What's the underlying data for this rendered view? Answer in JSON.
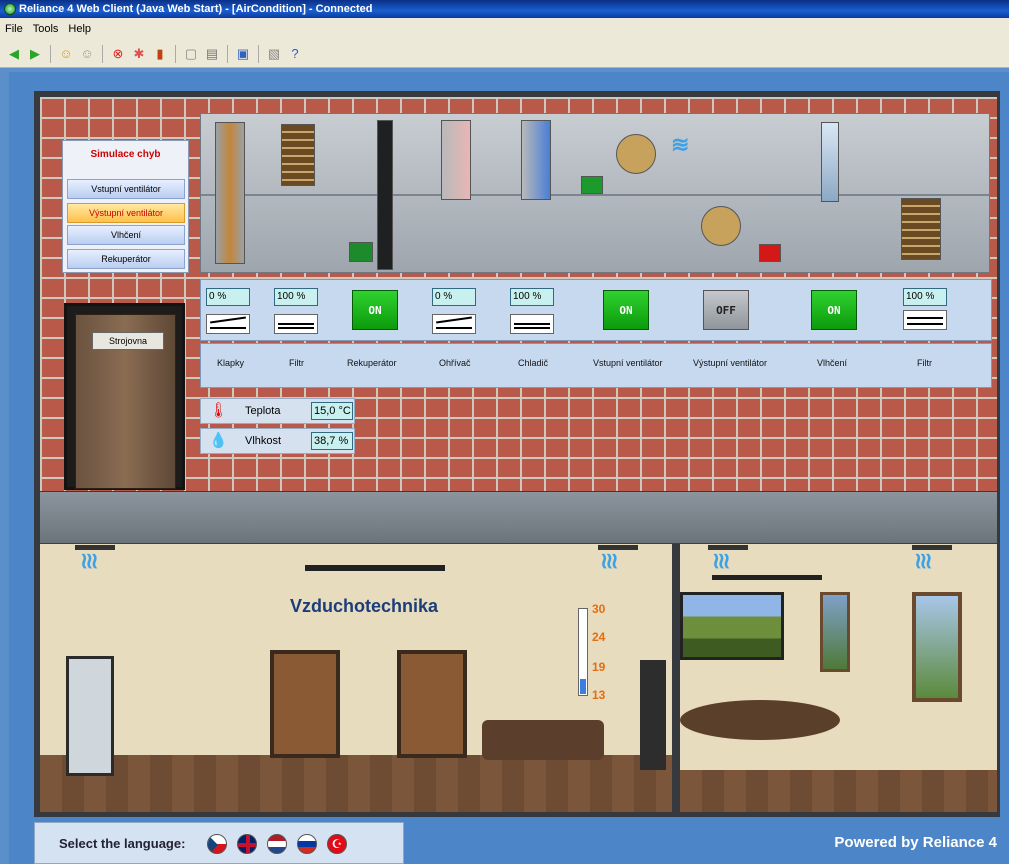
{
  "window": {
    "title": "Reliance 4 Web Client (Java Web Start) - [AirCondition] - Connected"
  },
  "menu": [
    "File",
    "Tools",
    "Help"
  ],
  "toolbar_icons": [
    "back-arrow-icon",
    "forward-arrow-icon",
    "user-login-icon",
    "user-logout-icon",
    "alarm-icon",
    "alarm-ack-icon",
    "trend-chart-icon",
    "blank-page-icon",
    "print-icon",
    "save-icon",
    "window-icon",
    "help-icon"
  ],
  "simulation": {
    "title": "Simulace chyb",
    "buttons": [
      "Vstupní ventilátor",
      "Výstupní ventilátor",
      "Vlhčení",
      "Rekuperátor"
    ],
    "active_index": 1
  },
  "controls": {
    "damper_in_value": "0 %",
    "filter_in_value": "100 %",
    "recuperator_state": "ON",
    "heater_value": "0 %",
    "cooler_value": "100 %",
    "inlet_fan_state": "ON",
    "outlet_fan_state": "OFF",
    "humidifier_state": "ON",
    "filter_out_value": "100 %"
  },
  "labels": [
    "Klapky",
    "Filtr",
    "Rekuperátor",
    "Ohřívač",
    "Chladič",
    "Vstupní ventilátor",
    "Výstupní ventilátor",
    "Vlhčení",
    "Filtr"
  ],
  "door_label": "Strojovna",
  "sensors": {
    "temp_label": "Teplota",
    "temp_value": "15,0 °C",
    "hum_label": "Vlhkost",
    "hum_value": "38,7 %"
  },
  "scene_title": "Vzduchotechnika",
  "thermometer": {
    "ticks": [
      "30",
      "24",
      "19",
      "13"
    ],
    "level_fraction": 0.18
  },
  "footer": {
    "language_label": "Select the language:",
    "powered": "Powered by Reliance 4"
  },
  "flags": [
    "czech-flag-icon",
    "uk-flag-icon",
    "dutch-flag-icon",
    "russian-flag-icon",
    "turkish-flag-icon"
  ],
  "colors": {
    "on": "#1ab51a",
    "off": "#9aa0a6",
    "active_sim": "#ffc04a",
    "alert_text": "#d10000"
  }
}
